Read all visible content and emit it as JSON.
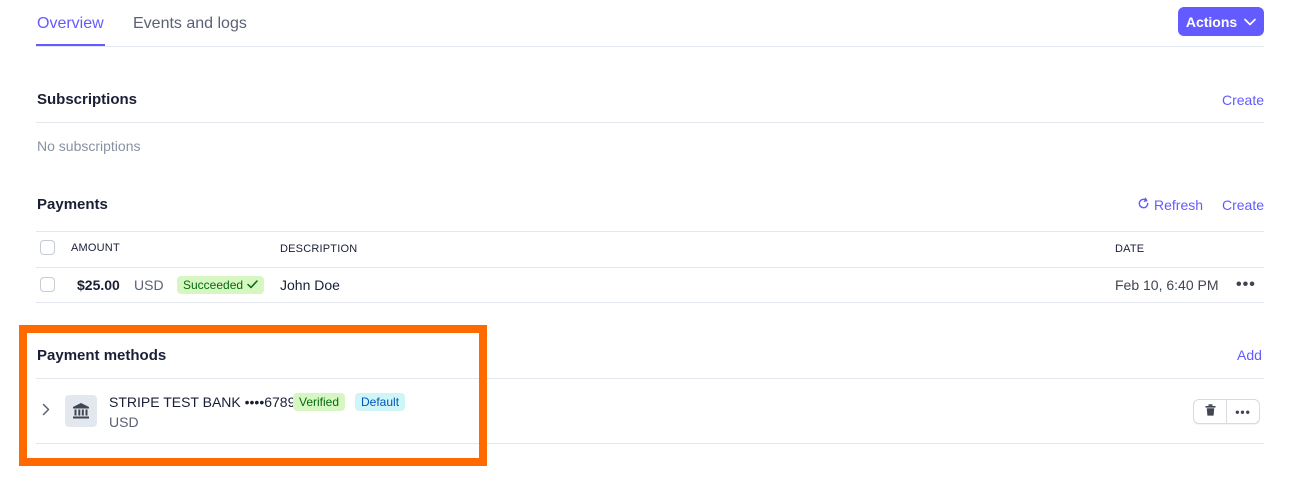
{
  "tabs": [
    {
      "label": "Overview",
      "active": true
    },
    {
      "label": "Events and logs",
      "active": false
    }
  ],
  "actions_button": {
    "label": "Actions",
    "icon": "chevron-down-icon",
    "color": "#635bff"
  },
  "subscriptions": {
    "title": "Subscriptions",
    "create_label": "Create",
    "empty_text": "No subscriptions"
  },
  "payments": {
    "title": "Payments",
    "refresh_label": "Refresh",
    "refresh_icon": "refresh-icon",
    "create_label": "Create",
    "columns": {
      "amount": "AMOUNT",
      "description": "DESCRIPTION",
      "date": "DATE"
    },
    "rows": [
      {
        "amount": "$25.00",
        "currency": "USD",
        "status": "Succeeded",
        "description": "John Doe",
        "date": "Feb 10, 6:40 PM"
      }
    ]
  },
  "payment_methods": {
    "title": "Payment methods",
    "add_label": "Add",
    "items": [
      {
        "name": "STRIPE TEST BANK ••••6789",
        "currency": "USD",
        "badges": [
          "Verified",
          "Default"
        ],
        "icon": "bank-icon"
      }
    ]
  },
  "colors": {
    "accent": "#635bff",
    "success_bg": "#d7f7c2",
    "success_text": "#05690d",
    "default_bg": "#cff5f6",
    "default_text": "#0055bc",
    "highlight": "#ff6a00"
  }
}
